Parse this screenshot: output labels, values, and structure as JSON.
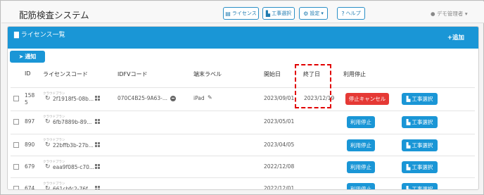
{
  "app": {
    "title": "配筋検査システム"
  },
  "nav": {
    "license": "ライセンス",
    "work_select": "工事選択",
    "settings": "設定",
    "help": "ヘルプ",
    "user": "デモ管理者"
  },
  "panel": {
    "title": "ライセンス一覧",
    "add": "追加",
    "notify": "通知"
  },
  "table": {
    "columns": {
      "id": "ID",
      "code": "ライセンスコード",
      "idfv": "IDFVコード",
      "terminal": "端末ラベル",
      "start": "開始日",
      "end": "終了日",
      "stop": "利用停止"
    },
    "plan_label": "クラウドプラン",
    "rows": [
      {
        "id": "158\n5",
        "code": "2f1918f5-08b...",
        "idfv": "070C4B25-9A63-...",
        "terminal": "iPad",
        "start": "2023/09/01",
        "end": "2023/12/19",
        "action": "停止キャンセル",
        "action_type": "cancel",
        "work": "工事選択"
      },
      {
        "id": "897",
        "code": "6fb7889b-89...",
        "idfv": "",
        "terminal": "",
        "start": "2023/05/01",
        "end": "",
        "action": "利用停止",
        "action_type": "stop",
        "work": "工事選択"
      },
      {
        "id": "890",
        "code": "22bffb3b-27b...",
        "idfv": "",
        "terminal": "",
        "start": "2023/04/05",
        "end": "",
        "action": "利用停止",
        "action_type": "stop",
        "work": "工事選択"
      },
      {
        "id": "679",
        "code": "eaa9f085-c70...",
        "idfv": "",
        "terminal": "",
        "start": "2022/12/08",
        "end": "",
        "action": "利用停止",
        "action_type": "stop",
        "work": "工事選択"
      },
      {
        "id": "674",
        "code": "661cbfc2-76f...",
        "idfv": "",
        "terminal": "",
        "start": "2022/12/01",
        "end": "",
        "action": "利用停止",
        "action_type": "stop",
        "work": "工事選択"
      }
    ]
  },
  "colors": {
    "primary": "#1a96d6",
    "danger": "#e53935",
    "highlight": "#e10000"
  },
  "icons": [
    "document-icon",
    "plus-icon",
    "send-icon",
    "refresh-icon",
    "grid-icon",
    "minus-circle-icon",
    "edit-icon",
    "gear-icon",
    "user-icon",
    "help-icon",
    "building-icon"
  ]
}
